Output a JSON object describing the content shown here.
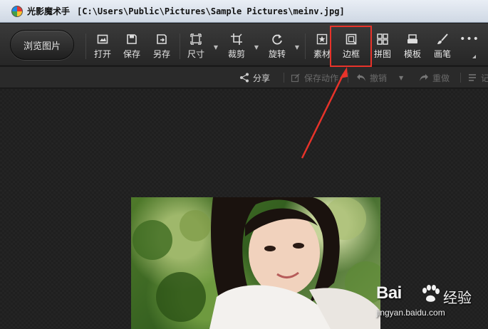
{
  "titlebar": {
    "app_name": "光影魔术手",
    "file_path": "[C:\\Users\\Public\\Pictures\\Sample Pictures\\meinv.jpg]"
  },
  "toolbar": {
    "browse_label": "浏览图片",
    "tools": [
      {
        "id": "open",
        "label": "打开",
        "icon": "open-icon"
      },
      {
        "id": "save",
        "label": "保存",
        "icon": "save-icon"
      },
      {
        "id": "saveas",
        "label": "另存",
        "icon": "save-as-icon"
      },
      {
        "id": "size",
        "label": "尺寸",
        "icon": "resize-icon"
      },
      {
        "id": "crop",
        "label": "裁剪",
        "icon": "crop-icon"
      },
      {
        "id": "rotate",
        "label": "旋转",
        "icon": "rotate-icon"
      },
      {
        "id": "material",
        "label": "素材",
        "icon": "star-icon"
      },
      {
        "id": "border",
        "label": "边框",
        "icon": "border-icon"
      },
      {
        "id": "collage",
        "label": "拼图",
        "icon": "grid-icon"
      },
      {
        "id": "template",
        "label": "模板",
        "icon": "template-icon"
      },
      {
        "id": "brush",
        "label": "画笔",
        "icon": "brush-icon"
      }
    ],
    "more_icon": "more-icon"
  },
  "subbar": {
    "share": "分享",
    "save_action": "保存动作",
    "undo": "撤销",
    "redo": "重做",
    "last_partial": "记"
  },
  "watermark": {
    "logo": "Bai",
    "brand": "经验",
    "url": "jingyan.baidu.com"
  },
  "colors": {
    "highlight": "#e8332a",
    "toolbar_bg": "#2e2e2e",
    "canvas_bg": "#1f1f1f"
  }
}
